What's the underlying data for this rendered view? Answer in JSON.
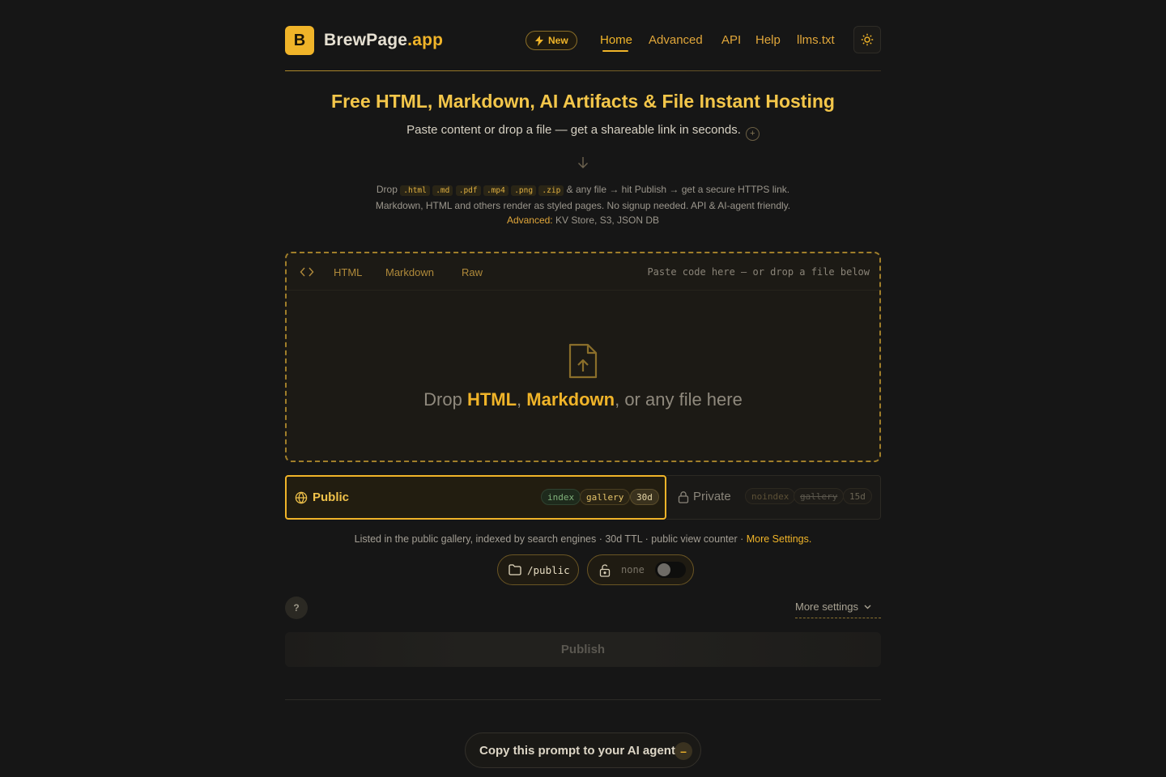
{
  "header": {
    "logo_letter": "B",
    "brand_name": "BrewPage",
    "brand_tld": ".app",
    "new_badge": "New",
    "nav": [
      "Home",
      "Advanced",
      "API",
      "Help",
      "llms.txt"
    ],
    "active_nav": "Home"
  },
  "hero": {
    "title": "Free HTML, Markdown, AI Artifacts & File Instant Hosting",
    "subtitle": "Paste content or drop a file — get a shareable link in seconds.",
    "expand_icon": "plus-circle-icon",
    "desc_prefix": "Drop",
    "extensions": [
      ".html",
      ".md",
      ".pdf",
      ".mp4",
      ".png",
      ".zip"
    ],
    "desc_after_ext": "& any file → hit Publish → get a secure HTTPS link. Markdown, HTML and others render as styled pages. No signup needed. API & AI-agent friendly.",
    "advanced_link": "Advanced:",
    "advanced_rest": "KV Store, S3, JSON DB"
  },
  "editor": {
    "tabs": [
      "HTML",
      "Markdown",
      "Raw"
    ],
    "paste_hint": "Paste code here — or drop a file below",
    "drop_prefix": "Drop",
    "drop_html": "HTML",
    "drop_comma": ",",
    "drop_markdown": "Markdown",
    "drop_suffix": ", or any file here"
  },
  "visibility": {
    "public": {
      "label": "Public",
      "chips": [
        "index",
        "gallery",
        "30d"
      ],
      "selected": true
    },
    "private": {
      "label": "Private",
      "chips": [
        "noindex",
        "gallery",
        "15d"
      ],
      "selected": false
    },
    "description": "Listed in the public gallery, indexed by search engines · 30d TTL · public view counter ·",
    "more_link": "More Settings."
  },
  "path": {
    "value": "/public"
  },
  "password": {
    "value": "none",
    "enabled": false
  },
  "help_label": "?",
  "more_settings": "More settings",
  "publish_label": "Publish",
  "copy_prompt": {
    "label": "Copy this prompt to your AI agent",
    "toggle": "–"
  },
  "colors": {
    "accent": "#f0b429",
    "background": "#161616",
    "surface": "#1c1a15"
  }
}
